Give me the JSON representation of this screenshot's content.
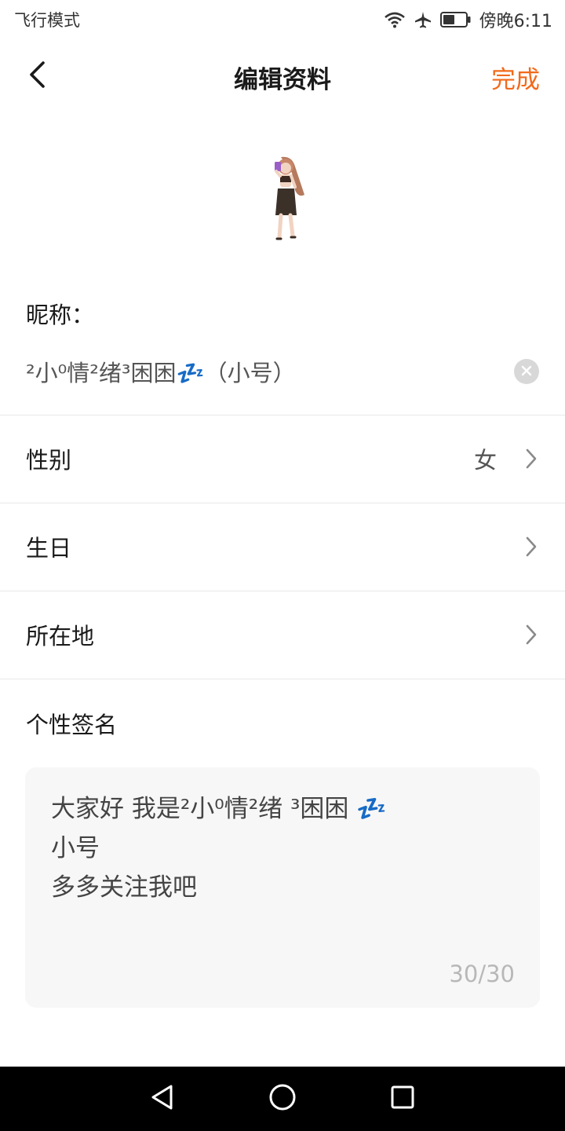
{
  "status_bar": {
    "left_text": "飞行模式",
    "time_text": "傍晚6:11",
    "icons": [
      "wifi-icon",
      "airplane-icon",
      "battery-icon"
    ]
  },
  "header": {
    "back_icon": "chevron-left-icon",
    "title": "编辑资料",
    "done_label": "完成"
  },
  "colors": {
    "accent": "#f26a1b",
    "divider": "#e8e8e8",
    "signature_bg": "#f7f7f7"
  },
  "nickname": {
    "label": "昵称：",
    "value": "²小⁰情²绪³困困💤（小号）",
    "clear_icon": "clear-circle-icon"
  },
  "rows": [
    {
      "label": "性别",
      "value": "女"
    },
    {
      "label": "生日",
      "value": ""
    },
    {
      "label": "所在地",
      "value": ""
    }
  ],
  "signature": {
    "label": "个性签名",
    "lines": [
      "大家好 我是²小⁰情²绪 ³困困 💤",
      "小号",
      "多多关注我吧"
    ],
    "counter": "30/30"
  },
  "nav_bar": {
    "icons": [
      "back-triangle-icon",
      "home-circle-icon",
      "recents-square-icon"
    ]
  }
}
